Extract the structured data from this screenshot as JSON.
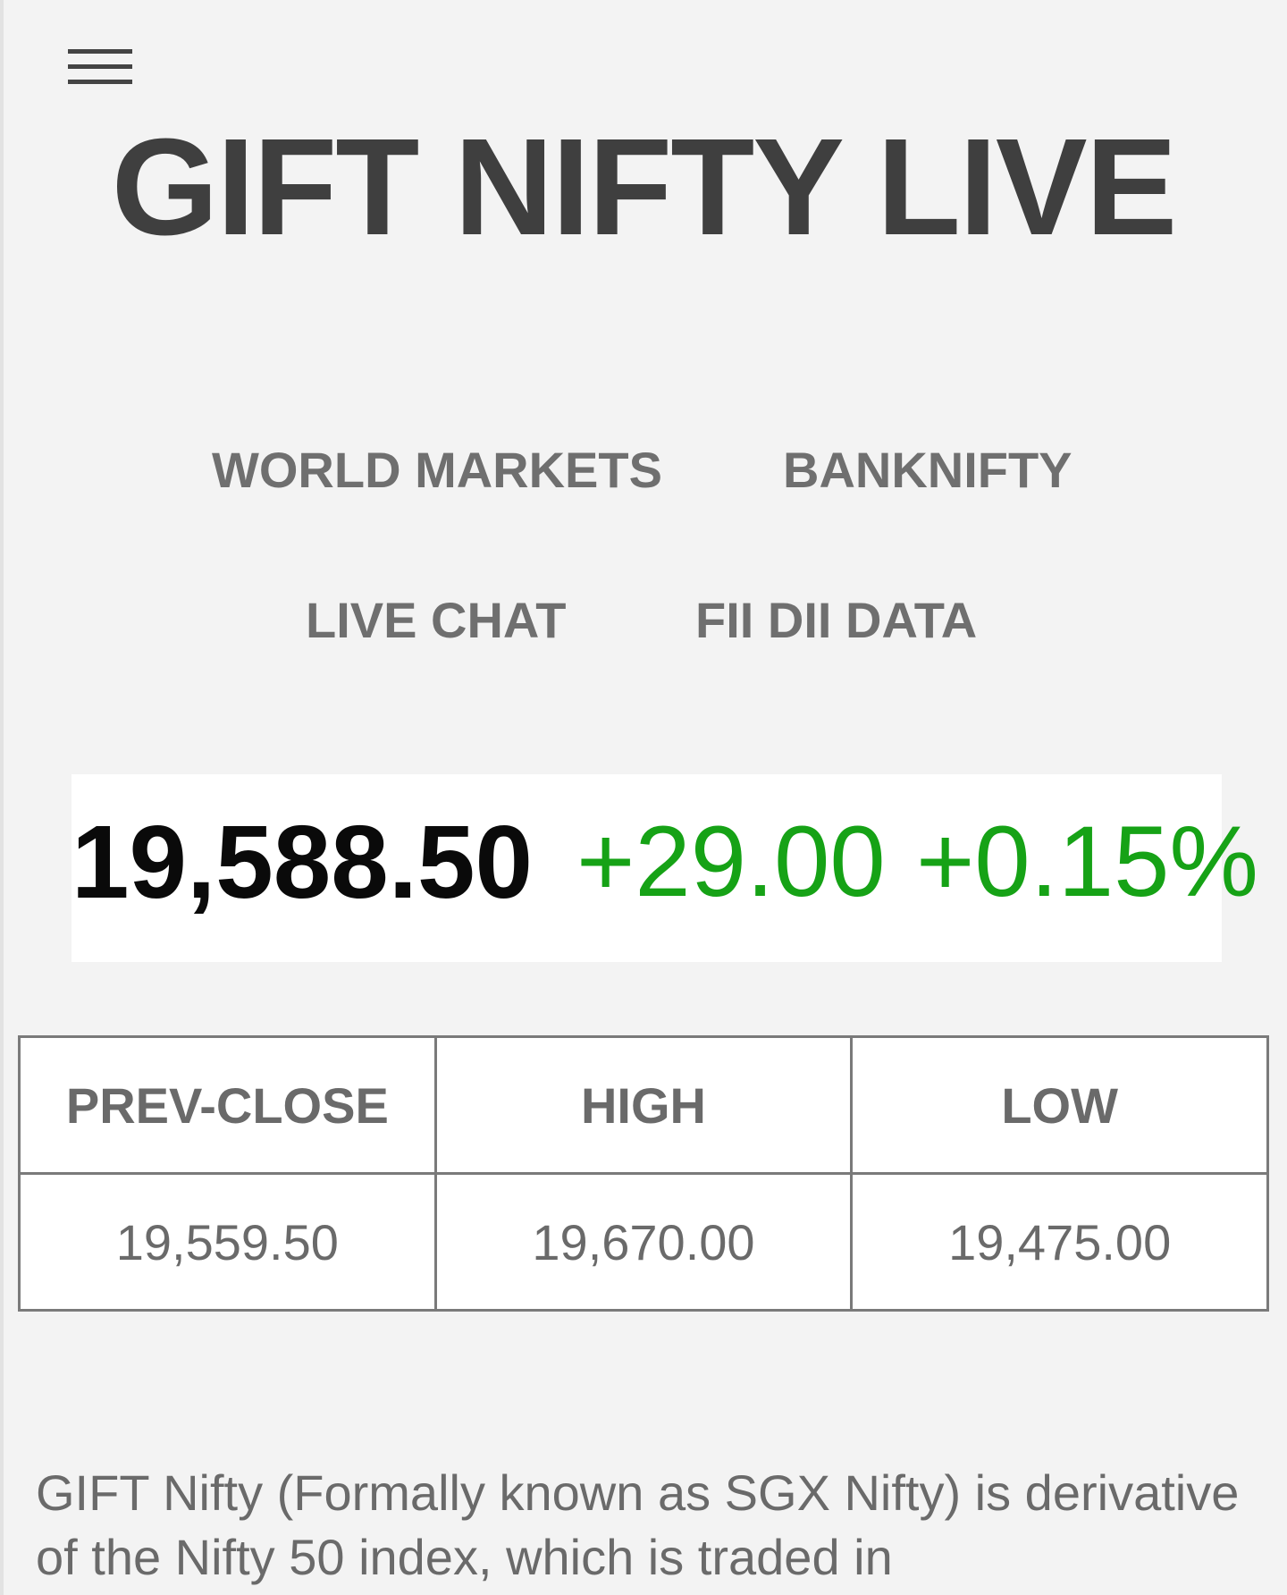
{
  "header": {
    "menu_icon": "hamburger-menu-icon",
    "title": "GIFT NIFTY LIVE"
  },
  "nav": {
    "world_markets": "WORLD MARKETS",
    "banknifty": "BANKNIFTY",
    "live_chat": "LIVE CHAT",
    "fii_dii_data": "FII DII DATA"
  },
  "quote": {
    "price": "19,588.50",
    "change": "+29.00",
    "change_pct": "+0.15%",
    "change_color": "#16a216"
  },
  "stats": {
    "headers": [
      "PREV-CLOSE",
      "HIGH",
      "LOW"
    ],
    "values": [
      "19,559.50",
      "19,670.00",
      "19,475.00"
    ]
  },
  "description": "GIFT Nifty (Formally known as SGX Nifty) is derivative of the Nifty 50 index, which is traded in"
}
